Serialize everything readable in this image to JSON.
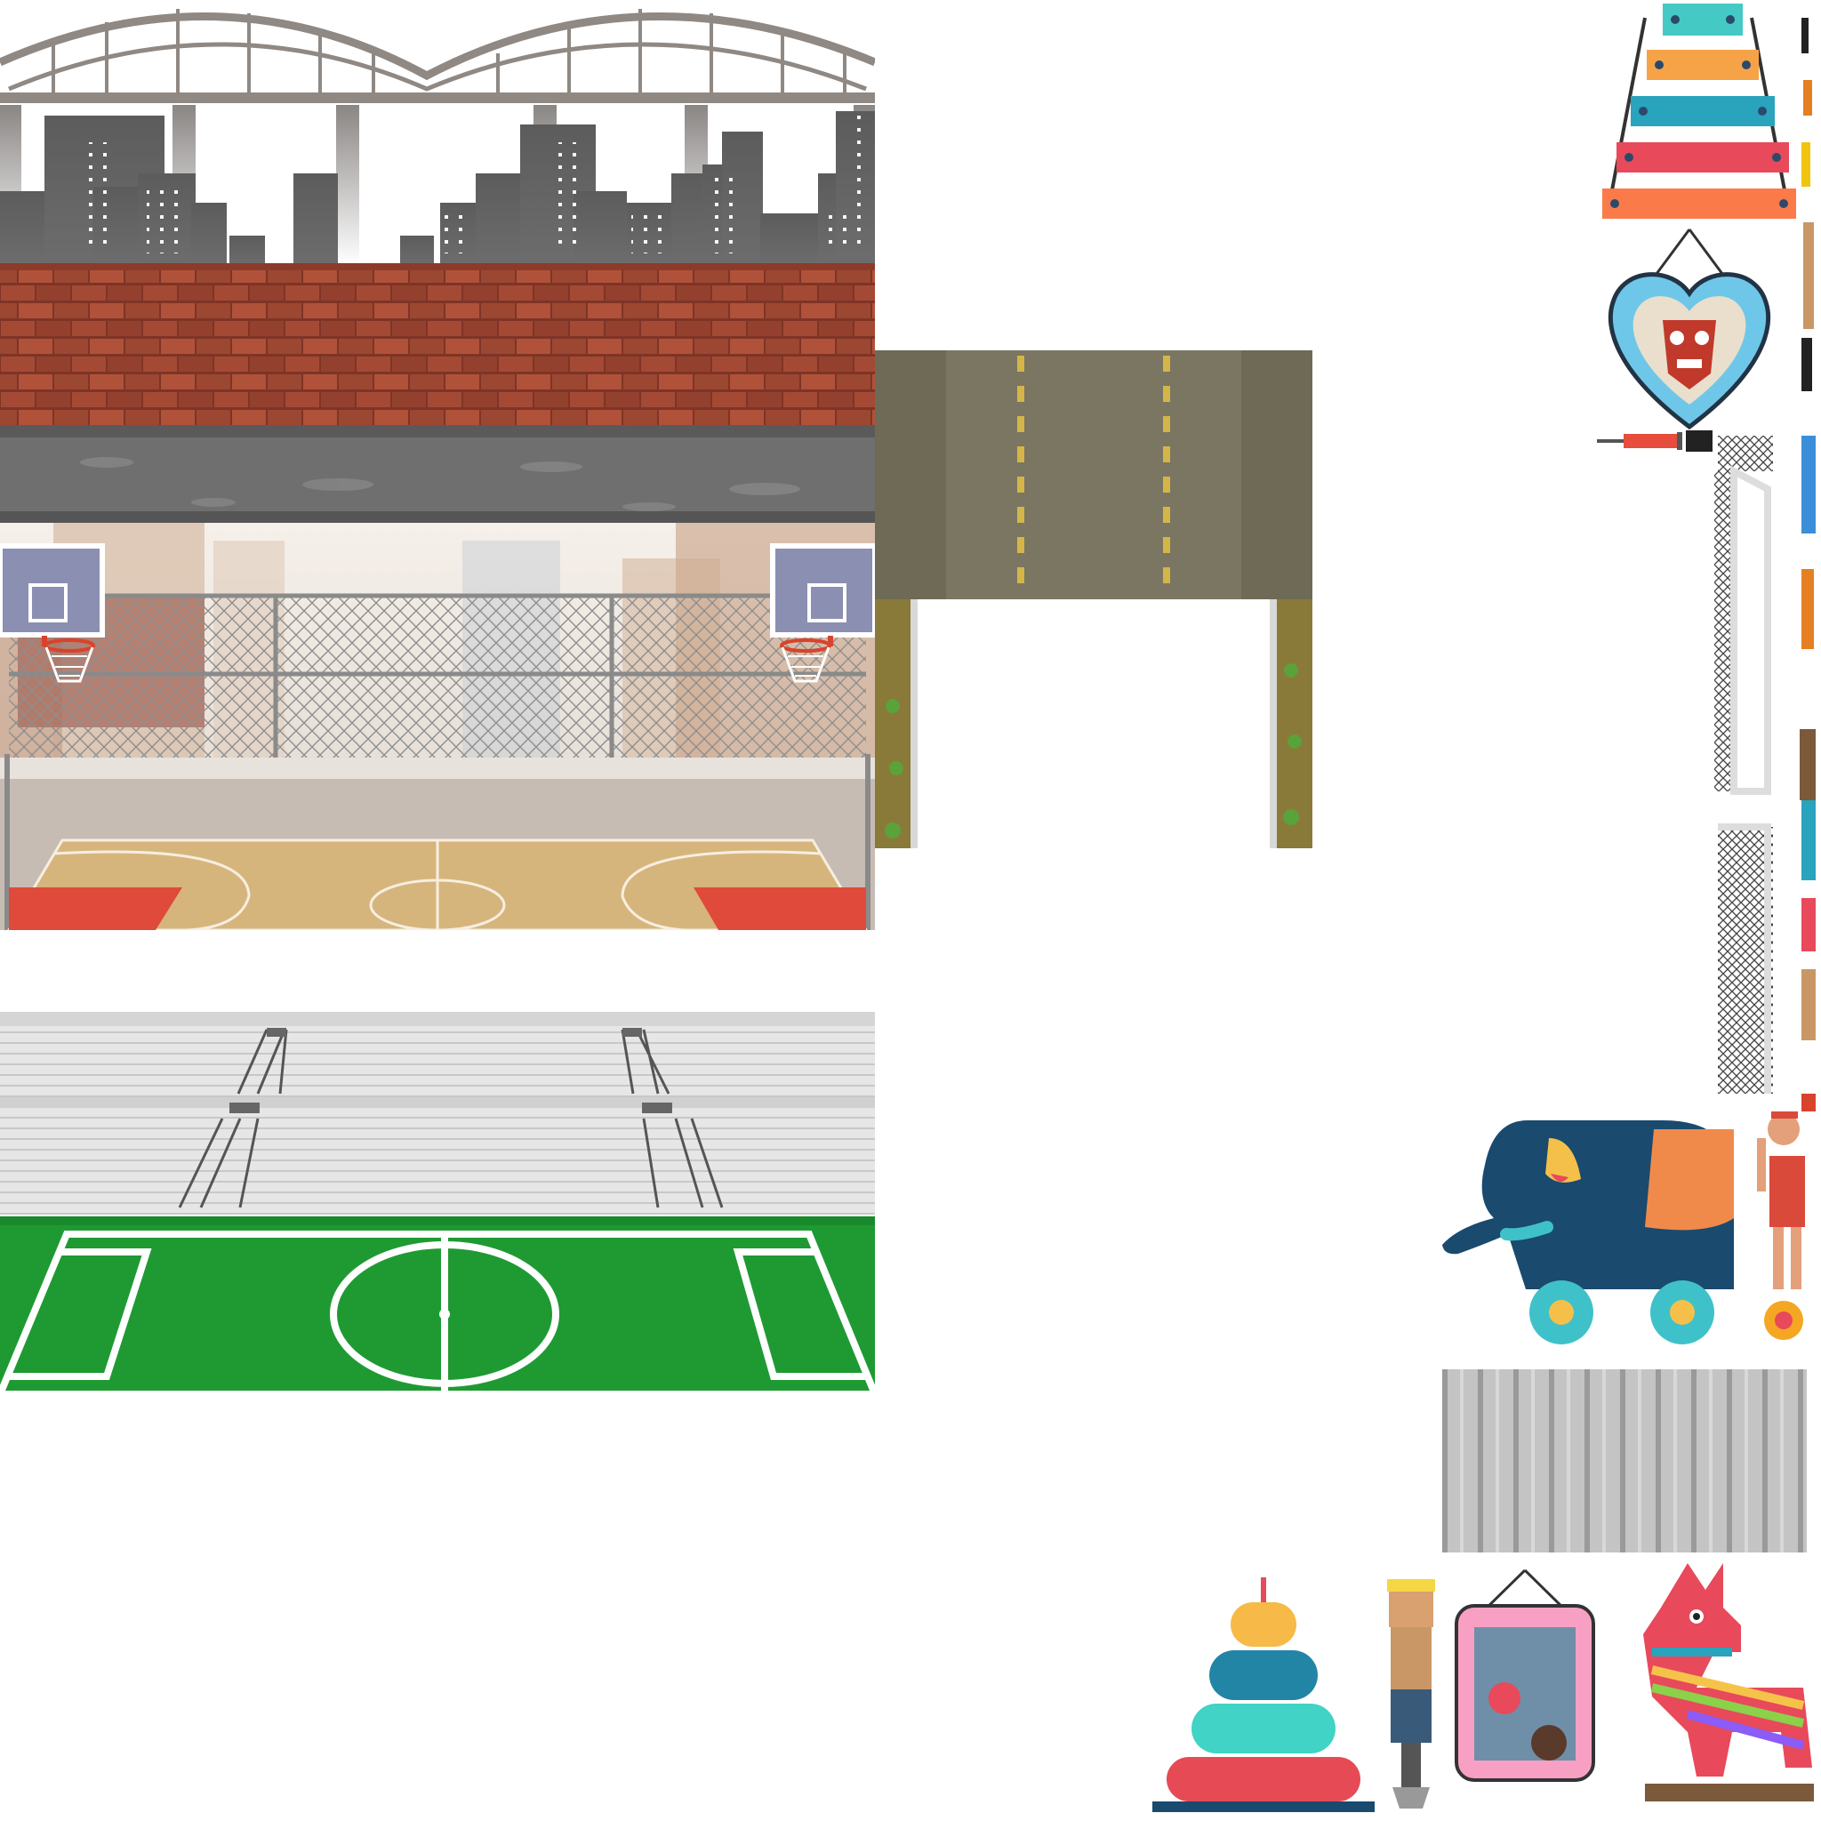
{
  "atlas": {
    "kind": "game sprite atlas",
    "background_color": "#ffffff"
  },
  "backgrounds": [
    {
      "id": "city-bridge-brick-wall",
      "name": "City skyline with bridge and brick wall",
      "colors": {
        "sky": "#ffffff",
        "bridge": "#8d8580",
        "buildings": "#5a5a5a",
        "brick": "#9c4530",
        "pavement": "#707070"
      }
    },
    {
      "id": "outdoor-basketball-court",
      "name": "Outdoor basketball court with chain-link fence",
      "colors": {
        "court": "#d8b878",
        "paint": "#e04a3a",
        "fence": "#9a9a9a",
        "haze": "#efe7df"
      }
    },
    {
      "id": "stadium-bleachers",
      "name": "Empty stadium bleachers",
      "colors": {
        "seats": "#e2e2e2",
        "rail": "#555555"
      }
    },
    {
      "id": "soccer-field",
      "name": "Soccer field markings",
      "colors": {
        "grass": "#1f9a33",
        "lines": "#ffffff"
      }
    },
    {
      "id": "dirt-road-top-down",
      "name": "Top-down road with dashed markings",
      "colors": {
        "asphalt": "#7b7662",
        "dash": "#d4b648",
        "rock": "#4a5a2a"
      }
    }
  ],
  "props": [
    {
      "id": "xylophone",
      "name": "Toy xylophone",
      "colors": [
        "#44c9c4",
        "#f6a348",
        "#2aa3bd",
        "#e8495b",
        "#fa7a4a"
      ]
    },
    {
      "id": "heart-frame-mask",
      "name": "Heart frame with tiki mask",
      "colors": [
        "#6ec7e8",
        "#c0392b"
      ]
    },
    {
      "id": "toy-elephant",
      "name": "Toy elephant on wheels",
      "colors": [
        "#1a4a6e",
        "#f08a4b",
        "#3fc1c9",
        "#f5c04a"
      ]
    },
    {
      "id": "stacking-rings",
      "name": "Stacking ring toy",
      "colors": [
        "#f7b947",
        "#2285a6",
        "#40d3c6",
        "#e64a55"
      ]
    },
    {
      "id": "pink-picture-frame",
      "name": "Pink picture frame",
      "colors": [
        "#f7a0c3"
      ]
    },
    {
      "id": "pinata-horse",
      "name": "Pinata horse",
      "colors": [
        "#e8495b",
        "#2aa3bd",
        "#f6c34a",
        "#8bd14a",
        "#8b5cf6"
      ]
    },
    {
      "id": "goal-net",
      "name": "Goal net frames",
      "colors": [
        "#ffffff",
        "#444444"
      ]
    },
    {
      "id": "metal-fence",
      "name": "Corrugated metal fence panel",
      "colors": [
        "#c4c4c4",
        "#9a9a9a"
      ]
    },
    {
      "id": "ragdoll-player",
      "name": "Ragdoll player figure",
      "colors": [
        "#d94a3a",
        "#e3a07a"
      ]
    },
    {
      "id": "pixel-character",
      "name": "Pixel character with hammer",
      "colors": [
        "#f5d743",
        "#3a5a7a"
      ]
    }
  ],
  "weapons_column": {
    "name": "Weapon and tool sprites strip",
    "count_hint": 20
  },
  "ui_text": {
    "note": ""
  }
}
